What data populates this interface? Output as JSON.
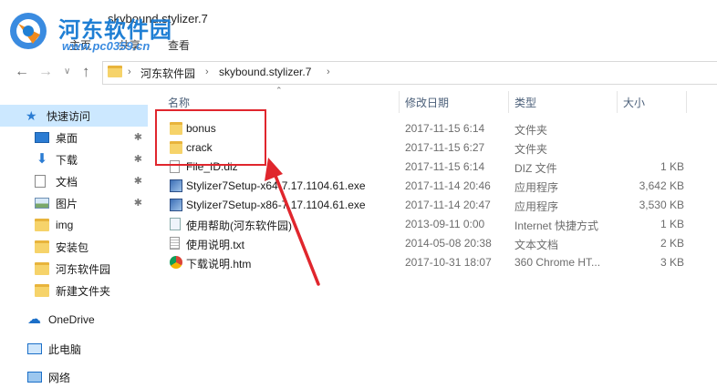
{
  "window": {
    "title": "skybound.stylizer.7"
  },
  "ribbon": {
    "home": "主页",
    "share": "共享",
    "view": "查看"
  },
  "watermark": {
    "title": "河东软件园",
    "url": "www.pc0359.cn"
  },
  "address": {
    "crumbs": [
      "河东软件园",
      "skybound.stylizer.7"
    ]
  },
  "sidebar": {
    "quick_access": "快速访问",
    "pinned": [
      "桌面",
      "下载",
      "文档",
      "图片"
    ],
    "folders": [
      "img",
      "安装包",
      "河东软件园",
      "新建文件夹"
    ],
    "onedrive": "OneDrive",
    "thispc": "此电脑",
    "network": "网络"
  },
  "columns": {
    "name": "名称",
    "date": "修改日期",
    "type": "类型",
    "size": "大小"
  },
  "files": [
    {
      "name": "bonus",
      "date": "2017-11-15 6:14",
      "type": "文件夹",
      "size": "",
      "icon": "folder-icon"
    },
    {
      "name": "crack",
      "date": "2017-11-15 6:27",
      "type": "文件夹",
      "size": "",
      "icon": "folder-icon"
    },
    {
      "name": "File_ID.diz",
      "date": "2017-11-15 6:14",
      "type": "DIZ 文件",
      "size": "1 KB",
      "icon": "file-icon"
    },
    {
      "name": "Stylizer7Setup-x64-7.17.1104.61.exe",
      "date": "2017-11-14 20:46",
      "type": "应用程序",
      "size": "3,642 KB",
      "icon": "installer-icon"
    },
    {
      "name": "Stylizer7Setup-x86-7.17.1104.61.exe",
      "date": "2017-11-14 20:47",
      "type": "应用程序",
      "size": "3,530 KB",
      "icon": "installer-icon"
    },
    {
      "name": "使用帮助(河东软件园)",
      "date": "2013-09-11 0:00",
      "type": "Internet 快捷方式",
      "size": "1 KB",
      "icon": "internet-shortcut-icon"
    },
    {
      "name": "使用说明.txt",
      "date": "2014-05-08 20:38",
      "type": "文本文档",
      "size": "2 KB",
      "icon": "text-file-icon"
    },
    {
      "name": "下载说明.htm",
      "date": "2017-10-31 18:07",
      "type": "360 Chrome HT...",
      "size": "3 KB",
      "icon": "chrome-html-icon"
    }
  ],
  "colors": {
    "selection": "#cce8ff",
    "annotation": "#e0262d",
    "watermark": "#1f7fd4"
  }
}
